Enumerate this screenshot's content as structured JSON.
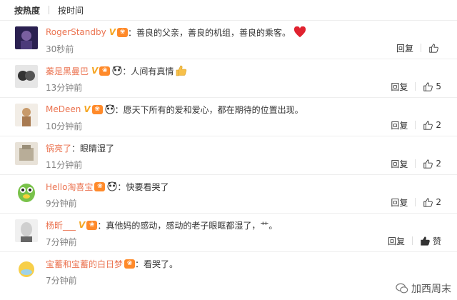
{
  "sort": {
    "hot_label": "按热度",
    "time_label": "按时间"
  },
  "comments": [
    {
      "user": "RogerStandby",
      "text": "善良的父亲，善良的机组，善良的乘客。",
      "time": "30秒前",
      "reply": "回复",
      "likes": ""
    },
    {
      "user": "蓁是黑曼巴",
      "text": "人间有真情",
      "time": "13分钟前",
      "reply": "回复",
      "likes": "5"
    },
    {
      "user": "MeDeen",
      "text": "愿天下所有的爱和爱心，都在期待的位置出现。",
      "time": "10分钟前",
      "reply": "回复",
      "likes": "2"
    },
    {
      "user": "锅亮了",
      "text": "眼睛湿了",
      "time": "11分钟前",
      "reply": "回复",
      "likes": "2"
    },
    {
      "user": "Hello淘喜宝",
      "text": "快要看哭了",
      "time": "9分钟前",
      "reply": "回复",
      "likes": "2"
    },
    {
      "user": "杨昕___",
      "text": "真他妈的感动，感动的老子眼眶都湿了，艹。",
      "time": "7分钟前",
      "reply": "回复",
      "likes": "赞"
    },
    {
      "user": "宝蓄和宝蓄的白日梦",
      "text": "看哭了。",
      "time": "7分钟前",
      "reply": "",
      "likes": ""
    }
  ],
  "watermark": {
    "text": "加西周末",
    "icon": "wechat-icon"
  },
  "colors": {
    "username": "#eb7350",
    "vip": "#f5a623",
    "heart": "#e0222f"
  }
}
